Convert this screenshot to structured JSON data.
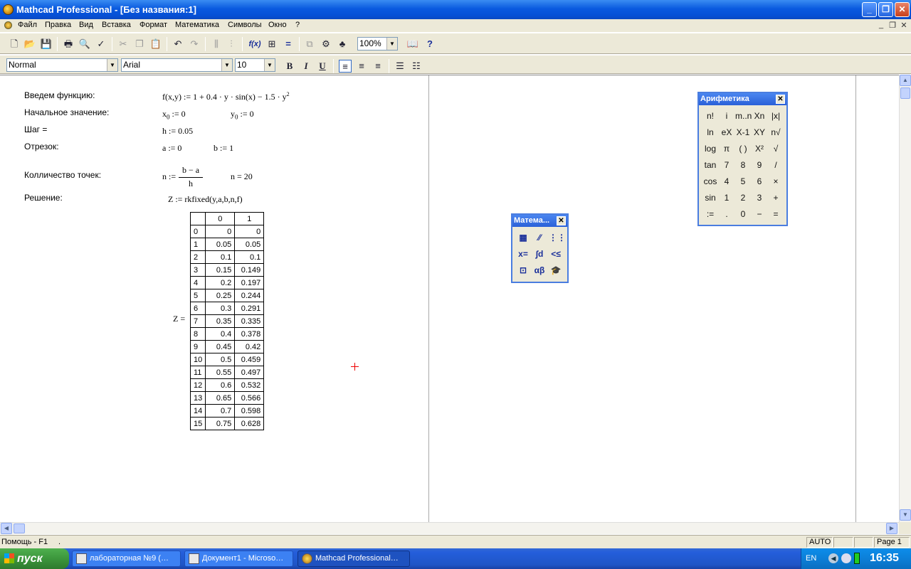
{
  "window": {
    "title": "Mathcad Professional - [Без названия:1]"
  },
  "menu": [
    "Файл",
    "Правка",
    "Вид",
    "Вставка",
    "Формат",
    "Математика",
    "Символы",
    "Окно",
    "?"
  ],
  "toolbar": {
    "zoom": "100%",
    "style": "Normal",
    "font": "Arial",
    "size": "10",
    "bold": "B",
    "italic": "I",
    "underline": "U"
  },
  "worksheet": {
    "labels": {
      "func": "Введем функцию:",
      "init": "Начальное значение:",
      "step": "Шаг =",
      "interval": "Отрезок:",
      "count": "Колличество точек:",
      "solution": "Решение:"
    },
    "math": {
      "func_lhs": "f(x,y) := 1 + 0.4 · y · sin(x) − 1.5 · y",
      "func_exp": "2",
      "x0_base": "x",
      "x0_sub": "0",
      "x0_rhs": " := 0",
      "y0_base": "y",
      "y0_sub": "0",
      "y0_rhs": " := 0",
      "h": "h := 0.05",
      "a": "a := 0",
      "b": "b := 1",
      "n_lhs": "n :=",
      "n_num": "b − a",
      "n_den": "h",
      "n_val": "n = 20",
      "z_def": "Z := rkfixed(y,a,b,n,f)",
      "z_eq": "Z ="
    },
    "matrix": {
      "col_headers": [
        "0",
        "1"
      ],
      "rows": [
        [
          "0",
          "0",
          "0"
        ],
        [
          "1",
          "0.05",
          "0.05"
        ],
        [
          "2",
          "0.1",
          "0.1"
        ],
        [
          "3",
          "0.15",
          "0.149"
        ],
        [
          "4",
          "0.2",
          "0.197"
        ],
        [
          "5",
          "0.25",
          "0.244"
        ],
        [
          "6",
          "0.3",
          "0.291"
        ],
        [
          "7",
          "0.35",
          "0.335"
        ],
        [
          "8",
          "0.4",
          "0.378"
        ],
        [
          "9",
          "0.45",
          "0.42"
        ],
        [
          "10",
          "0.5",
          "0.459"
        ],
        [
          "11",
          "0.55",
          "0.497"
        ],
        [
          "12",
          "0.6",
          "0.532"
        ],
        [
          "13",
          "0.65",
          "0.566"
        ],
        [
          "14",
          "0.7",
          "0.598"
        ],
        [
          "15",
          "0.75",
          "0.628"
        ]
      ]
    }
  },
  "arith_palette": {
    "title": "Арифметика",
    "cells": [
      "n!",
      "i",
      "m..n",
      "Xn",
      "|x|",
      "ln",
      "eX",
      "X-1",
      "XY",
      "n√",
      "log",
      "π",
      "( )",
      "X²",
      "√",
      "tan",
      "7",
      "8",
      "9",
      "/",
      "cos",
      "4",
      "5",
      "6",
      "×",
      "sin",
      "1",
      "2",
      "3",
      "+",
      ":=",
      ".",
      "0",
      "−",
      "="
    ]
  },
  "math_palette": {
    "title": "Матема...",
    "cells": [
      "▦",
      "⁄⁄",
      "⋮⋮",
      "x=",
      "∫d",
      "<≤",
      "⊡",
      "αβ",
      "🎓"
    ]
  },
  "status": {
    "help": "Помощь - F1",
    "mode": "AUTO",
    "page": "Page 1"
  },
  "taskbar": {
    "start": "пуск",
    "buttons": [
      "лабораторная №9 (…",
      "Документ1 - Microso…",
      "Mathcad Professional…"
    ],
    "lang": "EN",
    "time": "16:35"
  }
}
